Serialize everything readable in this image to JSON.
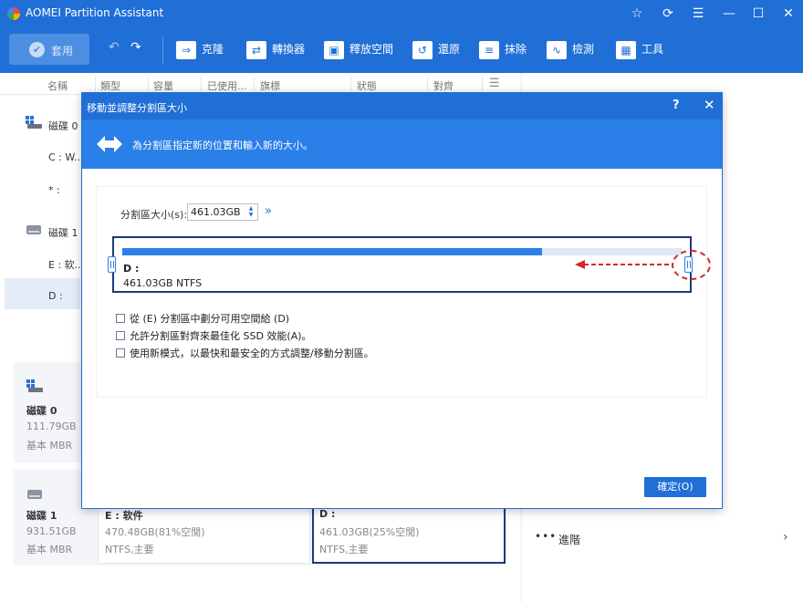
{
  "app": {
    "title": "AOMEI Partition Assistant"
  },
  "toolbar": {
    "apply_label": "套用",
    "tools": [
      {
        "label": "克隆",
        "icon": "clone-icon"
      },
      {
        "label": "轉換器",
        "icon": "converter-icon"
      },
      {
        "label": "釋放空間",
        "icon": "free-space-icon"
      },
      {
        "label": "還原",
        "icon": "restore-icon"
      },
      {
        "label": "抹除",
        "icon": "wipe-icon"
      },
      {
        "label": "檢測",
        "icon": "check-icon"
      },
      {
        "label": "工具",
        "icon": "tools-icon"
      }
    ]
  },
  "columns": [
    "名稱",
    "類型",
    "容量",
    "已使用...",
    "旗標",
    "狀態",
    "對齊"
  ],
  "tree": {
    "disk0": "磁碟 0",
    "c": "C : W...",
    "star": "* :",
    "disk1": "磁碟 1",
    "e": "E : 软...",
    "d": "D :"
  },
  "cards": {
    "disk0": {
      "name": "磁碟 0",
      "size": "111.79GB",
      "type": "基本 MBR"
    },
    "disk1": {
      "name": "磁碟 1",
      "size": "931.51GB",
      "type": "基本 MBR"
    },
    "partE": {
      "name": "E : 软件",
      "info": "470.48GB(81%空閒)",
      "fs": "NTFS,主要"
    },
    "partD": {
      "name": "D :",
      "info": "461.03GB(25%空閒)",
      "fs": "NTFS,主要"
    }
  },
  "dialog": {
    "title": "移動並調整分割區大小",
    "help": "?",
    "close": "✕",
    "banner_text": "為分割區指定新的位置和輸入新的大小。",
    "size_label": "分割區大小(s):",
    "size_value": "461.03GB",
    "partition_label": "D :",
    "partition_info": "461.03GB NTFS",
    "used_fraction": 0.75,
    "options": [
      "從 (E) 分割區中劃分可用空間給 (D)",
      "允許分割區對齊來最佳化 SSD 效能(A)。",
      "使用新模式，以最快和最安全的方式調整/移動分割區。"
    ],
    "ok_label": "確定(O)"
  },
  "right_panel": {
    "advanced_label": "進階"
  }
}
